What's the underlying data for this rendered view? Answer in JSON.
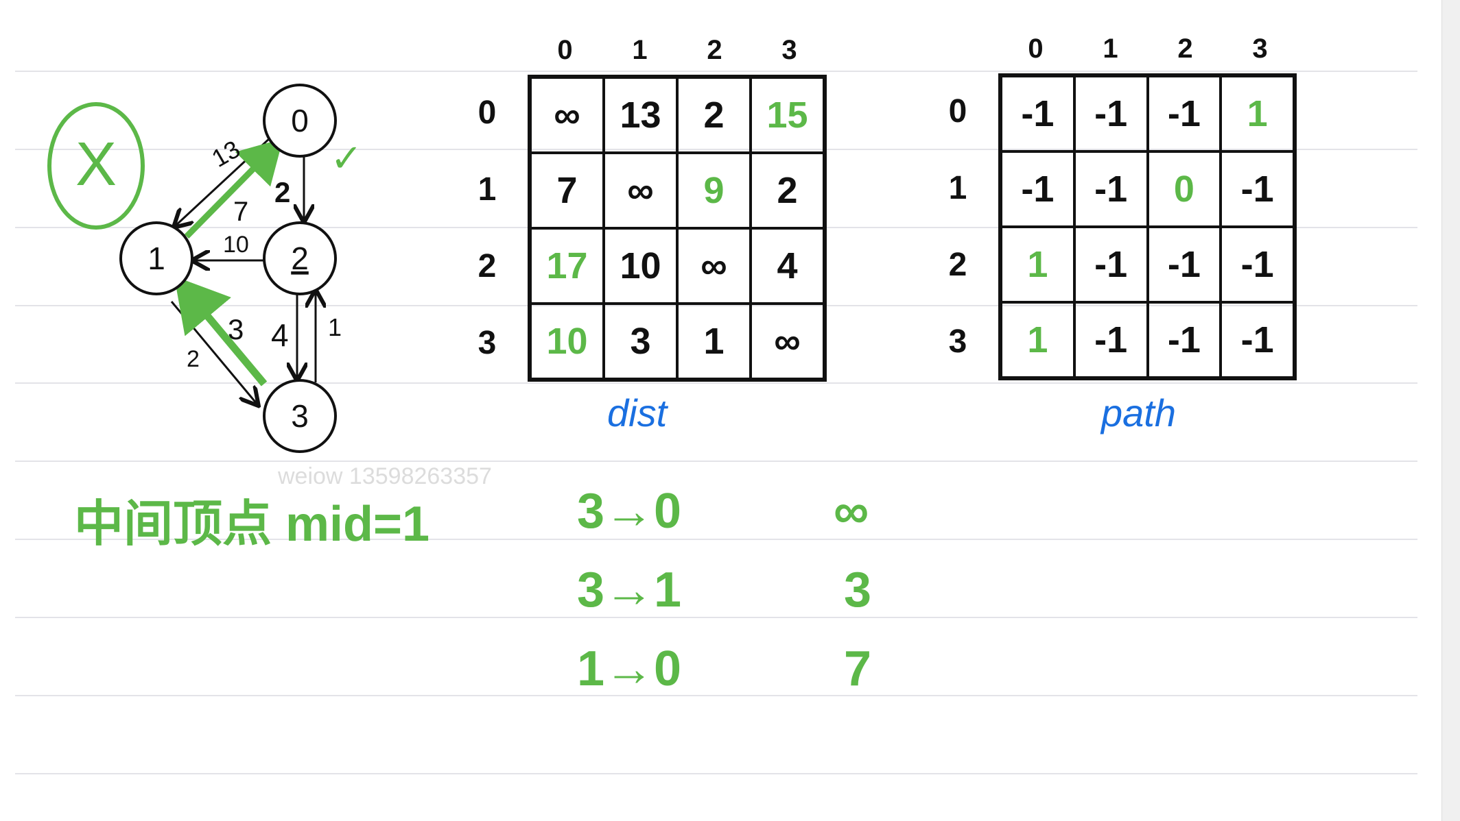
{
  "graph": {
    "nodes": [
      "0",
      "1",
      "2",
      "3"
    ],
    "edges": [
      {
        "from": "0",
        "to": "1",
        "weight": "13"
      },
      {
        "from": "0",
        "to": "2",
        "weight": "2"
      },
      {
        "from": "2",
        "to": "1",
        "weight": "10"
      },
      {
        "from": "2",
        "to": "3",
        "weight": "4"
      },
      {
        "from": "3",
        "to": "2",
        "weight": "1"
      },
      {
        "from": "1",
        "to": "3",
        "weight": "2"
      }
    ],
    "highlighted": [
      {
        "from": "1",
        "to": "0",
        "weight": "7"
      },
      {
        "from": "3",
        "to": "1",
        "weight": "3"
      }
    ],
    "mark": "X",
    "check": "✓"
  },
  "dist": {
    "title": "dist",
    "col_headers": [
      "0",
      "1",
      "2",
      "3"
    ],
    "row_headers": [
      "0",
      "1",
      "2",
      "3"
    ],
    "rows": [
      [
        "∞",
        "13",
        "2",
        "15"
      ],
      [
        "7",
        "∞",
        "9",
        "2"
      ],
      [
        "17",
        "10",
        "∞",
        "4"
      ],
      [
        "10",
        "3",
        "1",
        "∞"
      ]
    ],
    "highlight": [
      [
        false,
        false,
        false,
        true
      ],
      [
        false,
        false,
        true,
        false
      ],
      [
        true,
        false,
        false,
        false
      ],
      [
        true,
        false,
        false,
        false
      ]
    ]
  },
  "path": {
    "title": "path",
    "col_headers": [
      "0",
      "1",
      "2",
      "3"
    ],
    "row_headers": [
      "0",
      "1",
      "2",
      "3"
    ],
    "rows": [
      [
        "-1",
        "-1",
        "-1",
        "1"
      ],
      [
        "-1",
        "-1",
        "0",
        "-1"
      ],
      [
        "1",
        "-1",
        "-1",
        "-1"
      ],
      [
        "1",
        "-1",
        "-1",
        "-1"
      ]
    ],
    "highlight": [
      [
        false,
        false,
        false,
        true
      ],
      [
        false,
        false,
        true,
        false
      ],
      [
        true,
        false,
        false,
        false
      ],
      [
        true,
        false,
        false,
        false
      ]
    ]
  },
  "notes": {
    "mid": "中间顶点 mid=1",
    "lines": [
      {
        "route": "3→0",
        "value": "∞"
      },
      {
        "route": "3→1",
        "value": "3"
      },
      {
        "route": "1→0",
        "value": "7"
      }
    ]
  },
  "watermark": "weiow 13598263357",
  "colors": {
    "green": "#5cb848",
    "blue": "#1a6fe0",
    "ink": "#111111"
  }
}
